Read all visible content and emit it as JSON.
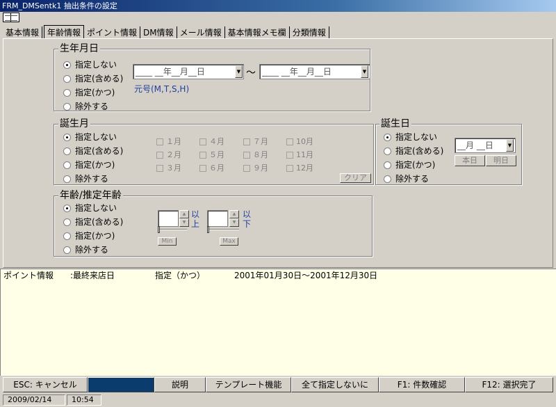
{
  "window": {
    "title": "FRM_DMSentk1 抽出条件の設定"
  },
  "tabs": [
    {
      "label": "基本情報"
    },
    {
      "label": "年齢情報"
    },
    {
      "label": "ポイント情報"
    },
    {
      "label": "DM情報"
    },
    {
      "label": "メール情報"
    },
    {
      "label": "基本情報メモ欄"
    },
    {
      "label": "分類情報"
    }
  ],
  "radio_options": [
    "指定しない",
    "指定(含める)",
    "指定(かつ)",
    "除外する"
  ],
  "birthdate": {
    "title": "生年月日",
    "from_value": "____  __年__月__日",
    "to_value": "____  __年__月__日",
    "range_sep": "～",
    "era_hint": "元号(M,T,S,H)"
  },
  "birth_month": {
    "title": "誕生月",
    "months": [
      "１月",
      "４月",
      "７月",
      "10月",
      "２月",
      "５月",
      "８月",
      "11月",
      "３月",
      "６月",
      "９月",
      "12月"
    ],
    "clear_label": "クリア"
  },
  "birthday": {
    "title": "誕生日",
    "value": "__月 __日",
    "today_label": "本日",
    "tomorrow_label": "明日"
  },
  "age": {
    "title": "年齢/推定年齢",
    "above_label_1": "以",
    "above_label_2": "上",
    "below_label_1": "以",
    "below_label_2": "下",
    "min_label": "Min",
    "max_label": "Max"
  },
  "info_lines": [
    {
      "category": "ポイント情報",
      "field": ":最終来店日",
      "mode": "指定（かつ）",
      "range": "2001年01月30日～2001年12月30日"
    }
  ],
  "function_keys": {
    "esc": "ESC: キャンセル",
    "help": "説明",
    "template": "テンプレート機能",
    "reset_all": "全て指定しないに",
    "f1": "F1: 件数確認",
    "f12": "F12: 選択完了"
  },
  "status": {
    "date": "2009/02/14",
    "time": "10:54"
  },
  "colors": {
    "title_start": "#0a246a",
    "info_bg": "#ffffe8",
    "era_hint": "#1f3f9f",
    "esc_dark": "#0a3c6e"
  }
}
